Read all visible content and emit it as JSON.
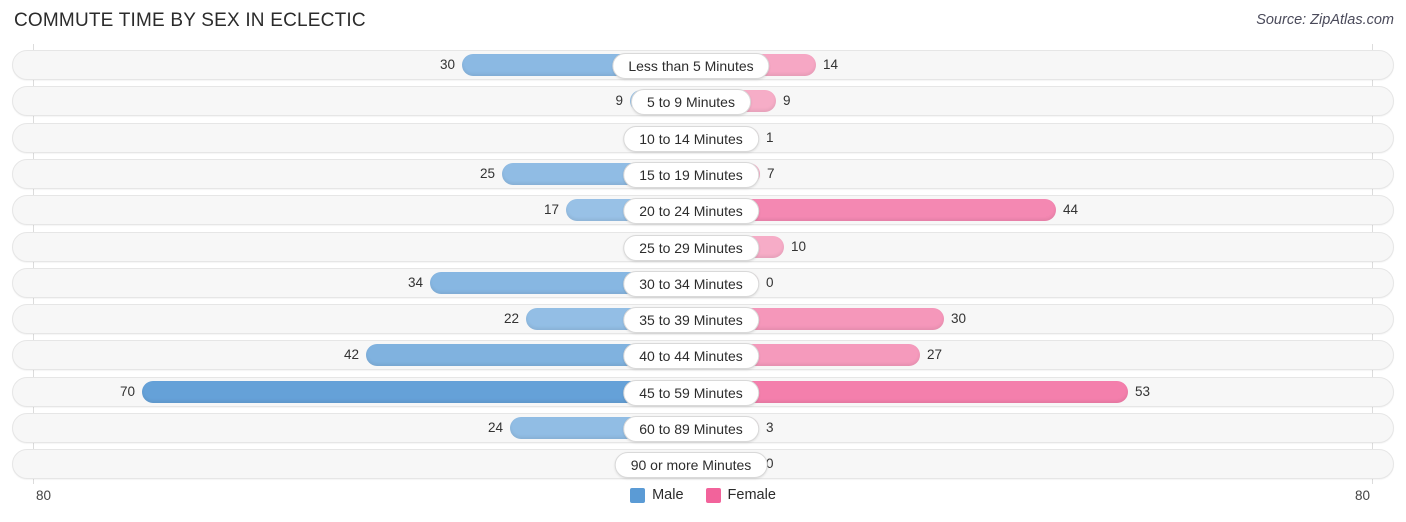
{
  "header": {
    "title": "COMMUTE TIME BY SEX IN ECLECTIC",
    "source": "Source: ZipAtlas.com"
  },
  "axis": {
    "left_tick": "80",
    "right_tick": "80"
  },
  "legend": {
    "items": [
      {
        "label": "Male",
        "color": "#5b9bd5"
      },
      {
        "label": "Female",
        "color": "#f2639b"
      }
    ]
  },
  "colors": {
    "male_base": "#5b9bd5",
    "male_light": "#a8cbeb",
    "female_base": "#f2639b",
    "female_light": "#f7b6cd",
    "row_bg": "#f7f7f7",
    "row_border": "#e6e6e6"
  },
  "chart_data": {
    "type": "bar",
    "title": "COMMUTE TIME BY SEX IN ECLECTIC",
    "subtitle": "",
    "orientation": "horizontal-diverging",
    "xlabel": "",
    "ylabel": "",
    "xlim": [
      80,
      80
    ],
    "axis_max": 80,
    "grid": false,
    "legend_position": "bottom-center",
    "categories": [
      "Less than 5 Minutes",
      "5 to 9 Minutes",
      "10 to 14 Minutes",
      "15 to 19 Minutes",
      "20 to 24 Minutes",
      "25 to 29 Minutes",
      "30 to 34 Minutes",
      "35 to 39 Minutes",
      "40 to 44 Minutes",
      "45 to 59 Minutes",
      "60 to 89 Minutes",
      "90 or more Minutes"
    ],
    "series": [
      {
        "name": "Male",
        "values": [
          30,
          9,
          3,
          25,
          17,
          0,
          34,
          22,
          42,
          70,
          24,
          0
        ]
      },
      {
        "name": "Female",
        "values": [
          14,
          9,
          1,
          7,
          44,
          10,
          0,
          30,
          27,
          53,
          3,
          0
        ]
      }
    ]
  }
}
